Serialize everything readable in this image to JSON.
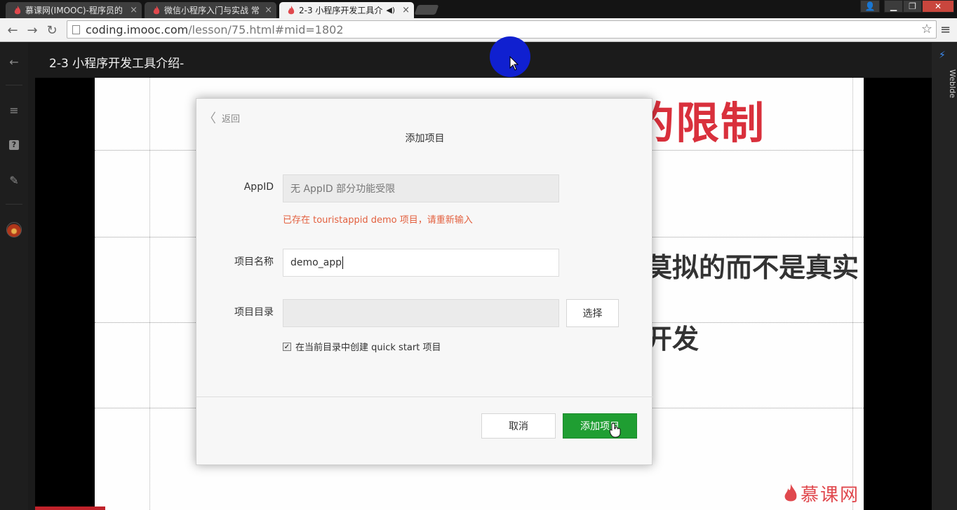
{
  "browser": {
    "tabs": [
      {
        "title": "慕课网(IMOOC)-程序员的",
        "active": false
      },
      {
        "title": "微信小程序入门与实战 常",
        "active": false
      },
      {
        "title": "2-3 小程序开发工具介",
        "active": true
      }
    ],
    "close_glyph": "×",
    "speaker_glyph": "◀)",
    "window_controls": {
      "user": "👤",
      "minimize": "▁",
      "restore": "❐",
      "close": "✕"
    },
    "nav": {
      "back": "←",
      "forward": "→",
      "reload": "↻"
    },
    "url": {
      "host": "coding.imooc.com",
      "path": "/lesson/75.html#mid=1802"
    },
    "star_glyph": "☆",
    "menu_glyph": "≡"
  },
  "rail": {
    "back_glyph": "←",
    "menu_glyph": "≡",
    "question_glyph": "?",
    "edit_glyph": "✎"
  },
  "header": {
    "title": "2-3 小程序开发工具介绍-"
  },
  "right_rail": {
    "icon": "⚡",
    "label": "WebIde"
  },
  "slide": {
    "title": "运存小程序只的限制",
    "line1": "莫拟的而不是真实",
    "line2": "开发",
    "watermark": "慕课网"
  },
  "dialog": {
    "back_label": "返回",
    "back_glyph": "〈",
    "title": "添加项目",
    "appid": {
      "label": "AppID",
      "placeholder": "无 AppID 部分功能受限",
      "error": "已存在 touristappid demo 项目，请重新输入"
    },
    "project_name": {
      "label": "项目名称",
      "value": "demo_app"
    },
    "project_dir": {
      "label": "项目目录",
      "value": "",
      "choose_label": "选择"
    },
    "quickstart": {
      "checked": true,
      "check_glyph": "✓",
      "label": "在当前目录中创建 quick start 项目"
    },
    "cancel_label": "取消",
    "add_label": "添加项目"
  },
  "colors": {
    "accent_green": "#1f9e32",
    "error_orange": "#e3603f",
    "slide_red": "#d9303c",
    "brand_red": "#e0484d",
    "cursor_blue": "#1020d0"
  }
}
